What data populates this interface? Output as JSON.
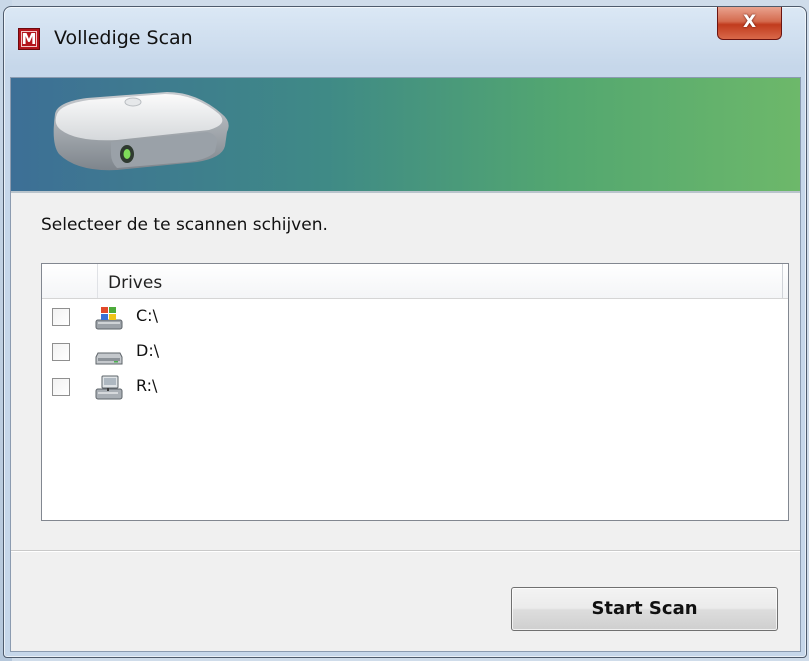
{
  "window": {
    "title": "Volledige Scan",
    "app_icon_letter": "M",
    "close_glyph": "X",
    "accent": "#b3141b"
  },
  "banner": {
    "icon": "hard-drive-icon",
    "gradient_start": "#3d6f96",
    "gradient_end": "#6db86a"
  },
  "main": {
    "instruction": "Selecteer de te scannen schijven.",
    "list": {
      "column_header": "Drives",
      "items": [
        {
          "label": "C:\\",
          "icon": "system-drive-icon",
          "checked": false
        },
        {
          "label": "D:\\",
          "icon": "optical-drive-icon",
          "checked": false
        },
        {
          "label": "R:\\",
          "icon": "network-drive-icon",
          "checked": false
        }
      ]
    }
  },
  "footer": {
    "start_button_label": "Start Scan"
  }
}
